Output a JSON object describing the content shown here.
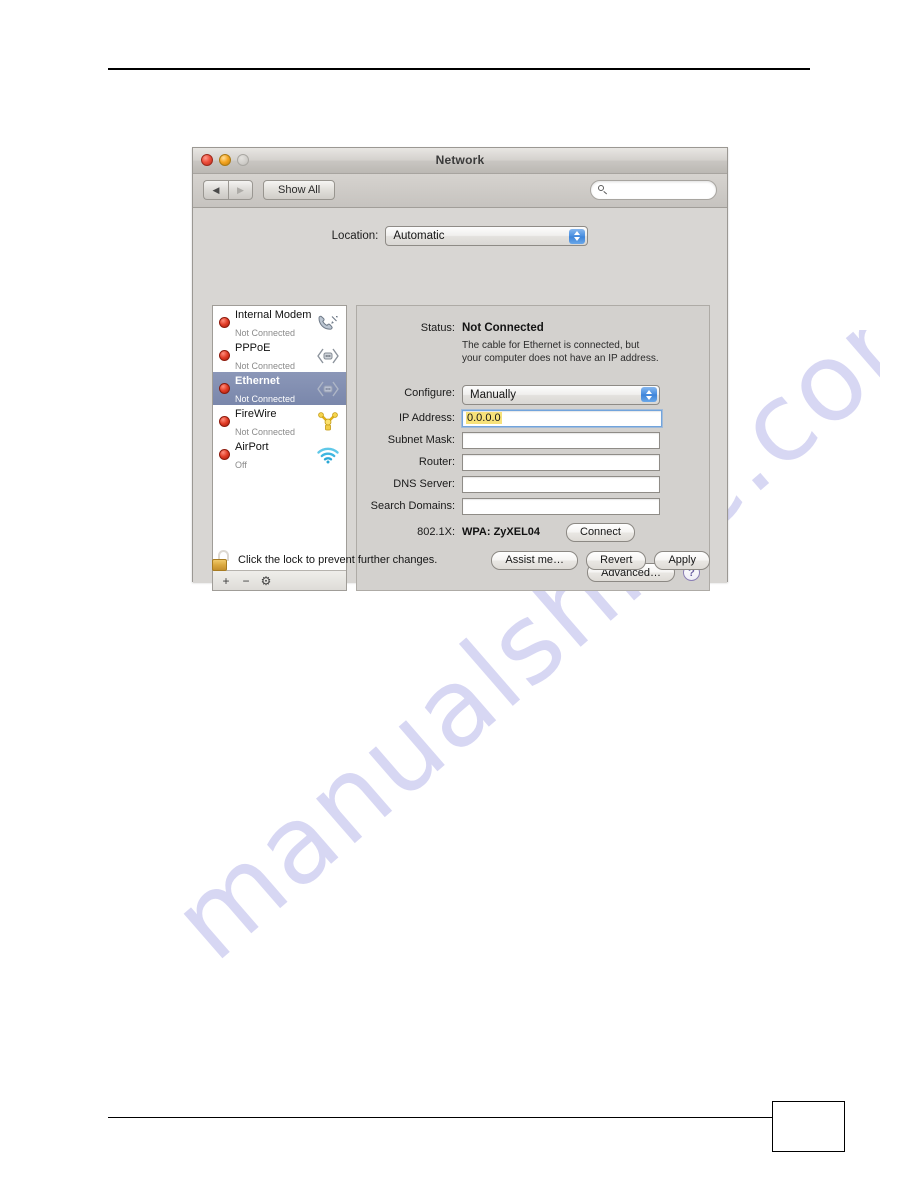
{
  "page": {
    "page_number": ""
  },
  "watermark": {
    "text": "manualshive.com"
  },
  "window": {
    "title": "Network",
    "traffic_lights": [
      "close-button",
      "minimize-button",
      "zoom-button"
    ],
    "toolbar": {
      "back_label": "◀",
      "forward_label": "▶",
      "show_all_label": "Show All",
      "search_placeholder": "",
      "search_value": "",
      "search_icon": "search-icon"
    }
  },
  "location": {
    "label": "Location:",
    "value": "Automatic"
  },
  "services": [
    {
      "name": "Internal Modem",
      "state": "Not Connected",
      "icon": "modem-phone-icon",
      "status_color": "#e13b25",
      "selected": false
    },
    {
      "name": "PPPoE",
      "state": "Not Connected",
      "icon": "pppoe-arrows-icon",
      "status_color": "#e13b25",
      "selected": false
    },
    {
      "name": "Ethernet",
      "state": "Not Connected",
      "icon": "ethernet-arrows-icon",
      "status_color": "#e13b25",
      "selected": true
    },
    {
      "name": "FireWire",
      "state": "Not Connected",
      "icon": "firewire-icon",
      "status_color": "#e13b25",
      "selected": false
    },
    {
      "name": "AirPort",
      "state": "Off",
      "icon": "airport-wifi-icon",
      "status_color": "#e13b25",
      "selected": false
    }
  ],
  "list_footer": {
    "add_label": "+",
    "remove_label": "−",
    "action_label": "⚙"
  },
  "detail": {
    "status": {
      "label": "Status:",
      "value": "Not Connected",
      "description_line1": "The cable for Ethernet is connected, but",
      "description_line2": "your computer does not have an IP address."
    },
    "fields": [
      {
        "label": "Configure:",
        "value": "Manually",
        "type": "popup"
      },
      {
        "label": "IP Address:",
        "value": "0.0.0.0",
        "type": "text",
        "focused": true,
        "selected_text": true
      },
      {
        "label": "Subnet Mask:",
        "value": "",
        "type": "text",
        "focused": false
      },
      {
        "label": "Router:",
        "value": "",
        "type": "text",
        "focused": false
      },
      {
        "label": "DNS Server:",
        "value": "",
        "type": "text",
        "focused": false
      },
      {
        "label": "Search Domains:",
        "value": "",
        "type": "text",
        "focused": false
      }
    ],
    "dot1x": {
      "label": "802.1X:",
      "value": "WPA: ZyXEL04",
      "connect_label": "Connect"
    },
    "advanced_label": "Advanced…",
    "help_label": "?"
  },
  "bottom": {
    "lock_icon": "open-padlock-icon",
    "lock_text": "Click the lock to prevent further changes.",
    "assist_label": "Assist me…",
    "revert_label": "Revert",
    "apply_label": "Apply"
  }
}
